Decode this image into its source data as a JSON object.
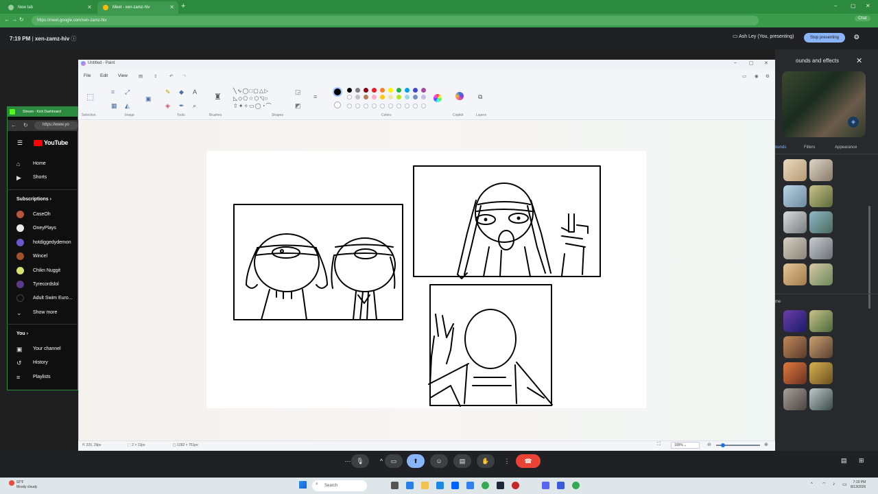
{
  "browser": {
    "tabs": [
      {
        "title": "New tab"
      },
      {
        "title": "Meet - xen-zamz-hiv"
      }
    ],
    "url": "https://meet.google.com/xen-zamz-hiv"
  },
  "meet": {
    "time": "7:19 PM",
    "separator": "|",
    "code": "xen-zamz-hiv",
    "presenting": "Ash Ley (You, presenting)",
    "stop": "Stop presenting"
  },
  "effects_panel": {
    "title": "Backgrounds and effects",
    "title_visible": "ounds and effects",
    "tabs": [
      "ounds",
      "Filters",
      "Appearance"
    ],
    "section": "me"
  },
  "youtube": {
    "window_title": "Stream - Kick Dashboard",
    "url": "https://www.yo",
    "logo": "YouTube",
    "nav": [
      "Home",
      "Shorts"
    ],
    "subs_header": "Subscriptions",
    "subscriptions": [
      "CaseOh",
      "OneyPlays",
      "hotdiggedydemon",
      "Wincel",
      "Chikn Nuggit",
      "Tyrecordslol",
      "Adult Swim Euro..."
    ],
    "show_more": "Show more",
    "you_header": "You",
    "you_items": [
      "Your channel",
      "History",
      "Playlists"
    ]
  },
  "paint": {
    "title": "Untitled - Paint",
    "menu": [
      "File",
      "Edit",
      "View"
    ],
    "groups": [
      "Selection",
      "Image",
      "Tools",
      "Brushes",
      "Shapes",
      "Colors",
      "Copilot",
      "Layers"
    ],
    "colors_row1": [
      "#000000",
      "#7f7f7f",
      "#880015",
      "#ed1c24",
      "#ff7f27",
      "#fff200",
      "#22b14c",
      "#00a2e8",
      "#3f48cc",
      "#a349a4"
    ],
    "colors_row2": [
      "#ffffff",
      "#c3c3c3",
      "#b97a57",
      "#ffaec9",
      "#ffc90e",
      "#efe4b0",
      "#b5e61d",
      "#99d9ea",
      "#7092be",
      "#c8bfe7"
    ],
    "status": {
      "cursor": "220, 29px",
      "selection": "2 × 12px",
      "canvas_size": "1282 × 751px",
      "zoom": "100%"
    }
  },
  "taskbar": {
    "weather_temp": "92°F",
    "weather_desc": "Mostly cloudy",
    "search": "Search",
    "time": "7:19 PM",
    "date": "8/13/2026"
  }
}
